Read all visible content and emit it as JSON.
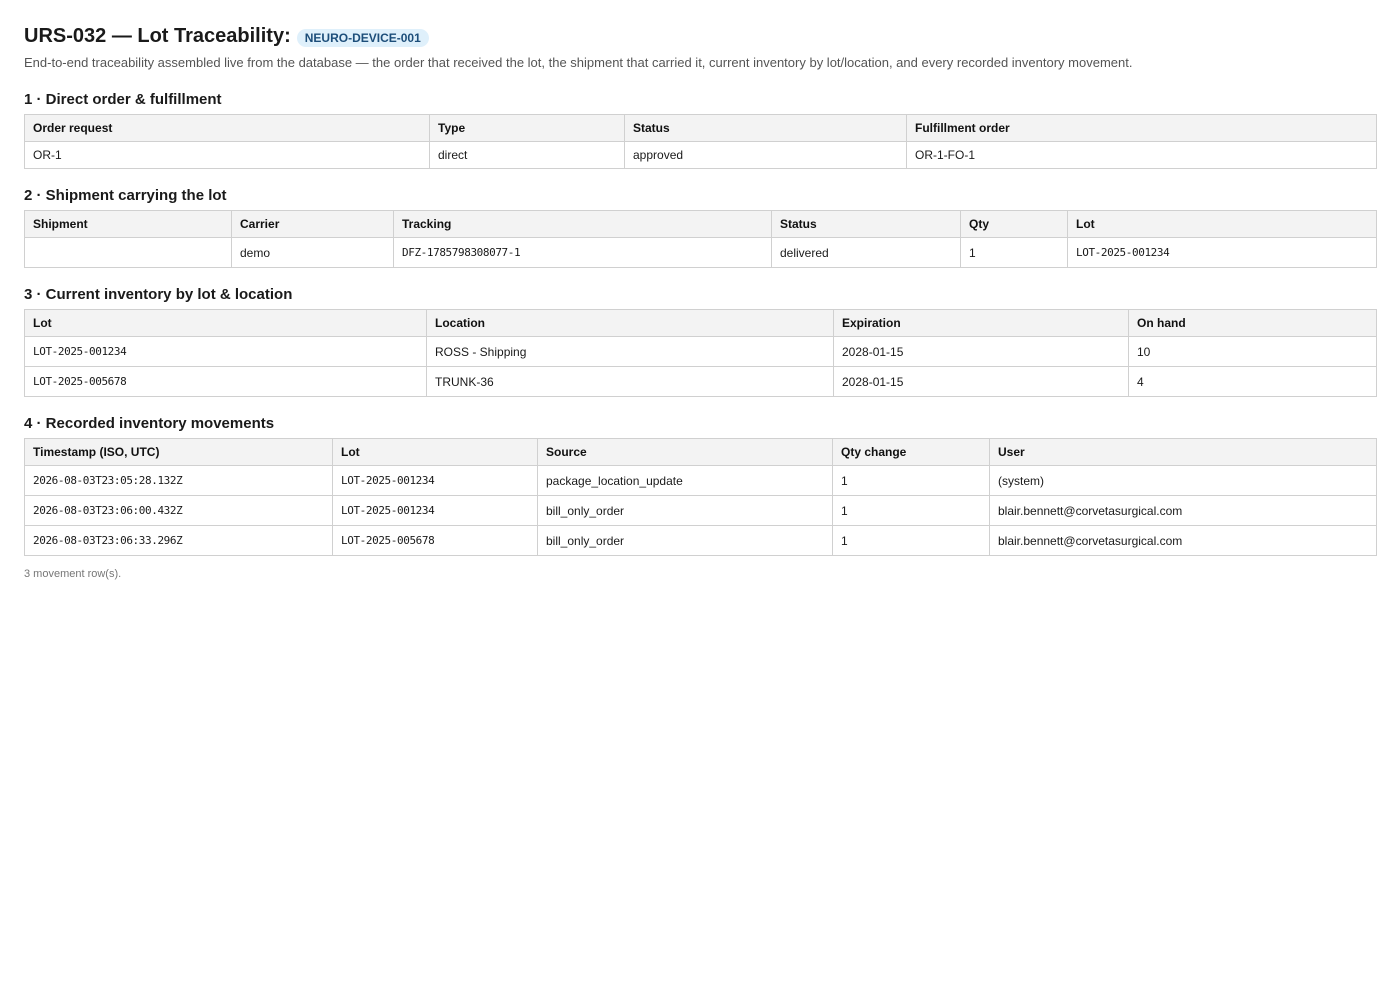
{
  "header": {
    "title": "URS-032 — Lot Traceability:",
    "badge": "NEURO-DEVICE-001",
    "subtitle": "End-to-end traceability assembled live from the database — the order that received the lot, the shipment that carried it, current inventory by lot/location, and every recorded inventory movement."
  },
  "sections": {
    "order": {
      "heading": "1 · Direct order & fulfillment",
      "columns": [
        "Order request",
        "Type",
        "Status",
        "Fulfillment order"
      ],
      "rows": [
        [
          "OR-1",
          "direct",
          "approved",
          "OR-1-FO-1"
        ]
      ]
    },
    "shipment": {
      "heading": "2 · Shipment carrying the lot",
      "columns": [
        "Shipment",
        "Carrier",
        "Tracking",
        "Status",
        "Qty",
        "Lot"
      ],
      "rows": [
        [
          "",
          "demo",
          "DFZ-1785798308077-1",
          "delivered",
          "1",
          "LOT-2025-001234"
        ]
      ]
    },
    "inventory": {
      "heading": "3 · Current inventory by lot & location",
      "columns": [
        "Lot",
        "Location",
        "Expiration",
        "On hand"
      ],
      "rows": [
        [
          "LOT-2025-001234",
          "ROSS - Shipping",
          "2028-01-15",
          "10"
        ],
        [
          "LOT-2025-005678",
          "TRUNK-36",
          "2028-01-15",
          "4"
        ]
      ]
    },
    "movements": {
      "heading": "4 · Recorded inventory movements",
      "columns": [
        "Timestamp (ISO, UTC)",
        "Lot",
        "Source",
        "Qty change",
        "User"
      ],
      "rows": [
        [
          "2026-08-03T23:05:28.132Z",
          "LOT-2025-001234",
          "package_location_update",
          "1",
          "(system)"
        ],
        [
          "2026-08-03T23:06:00.432Z",
          "LOT-2025-001234",
          "bill_only_order",
          "1",
          "blair.bennett@corvetasurgical.com"
        ],
        [
          "2026-08-03T23:06:33.296Z",
          "LOT-2025-005678",
          "bill_only_order",
          "1",
          "blair.bennett@corvetasurgical.com"
        ]
      ],
      "footnote": "3 movement row(s)."
    }
  },
  "colors": {
    "badge_bg": "#dff0fb",
    "badge_text": "#1d4e7a",
    "header_bg": "#f3f3f3",
    "border": "#d0d0d0"
  }
}
